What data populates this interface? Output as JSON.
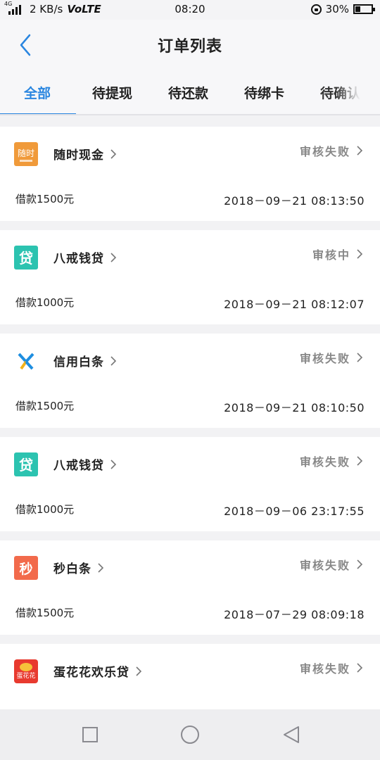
{
  "status_bar": {
    "network_tag": "4G",
    "speed": "2 KB/s",
    "volte": "VoLTE",
    "time": "08:20",
    "battery": "30%",
    "battery_level": 0.3
  },
  "header": {
    "title": "订单列表",
    "back_icon": "chevron-left-icon",
    "accent_color": "#2a86e0"
  },
  "tabs": [
    {
      "label": "全部"
    },
    {
      "label": "待提现"
    },
    {
      "label": "待还款"
    },
    {
      "label": "待绑卡"
    },
    {
      "label": "待确认"
    }
  ],
  "orders": [
    {
      "name": "随时现金",
      "status": "审核失败",
      "amount": "借款1500元",
      "date": "2018－09－21 08:13:50",
      "logo_text": "随时",
      "logo_color": "#f09a3a"
    },
    {
      "name": "八戒钱贷",
      "status": "审核中",
      "amount": "借款1000元",
      "date": "2018－09－21 08:12:07",
      "logo_text": "贷",
      "logo_color": "#2cc3b0"
    },
    {
      "name": "信用白条",
      "status": "审核失败",
      "amount": "借款1500元",
      "date": "2018－09－21 08:10:50",
      "logo_text": "X",
      "logo_color": "#ffffff"
    },
    {
      "name": "八戒钱贷",
      "status": "审核失败",
      "amount": "借款1000元",
      "date": "2018－09－06 23:17:55",
      "logo_text": "贷",
      "logo_color": "#2cc3b0"
    },
    {
      "name": "秒白条",
      "status": "审核失败",
      "amount": "借款1500元",
      "date": "2018－07－29 08:09:18",
      "logo_text": "秒",
      "logo_color": "#f26a4b"
    },
    {
      "name": "蛋花花欢乐贷",
      "status": "审核失败",
      "amount": "",
      "date": "",
      "logo_text": "蛋花花",
      "logo_color": "#e83a2f"
    }
  ],
  "navbar": {
    "recent_icon": "square-icon",
    "home_icon": "circle-icon",
    "back_icon": "triangle-back-icon"
  }
}
